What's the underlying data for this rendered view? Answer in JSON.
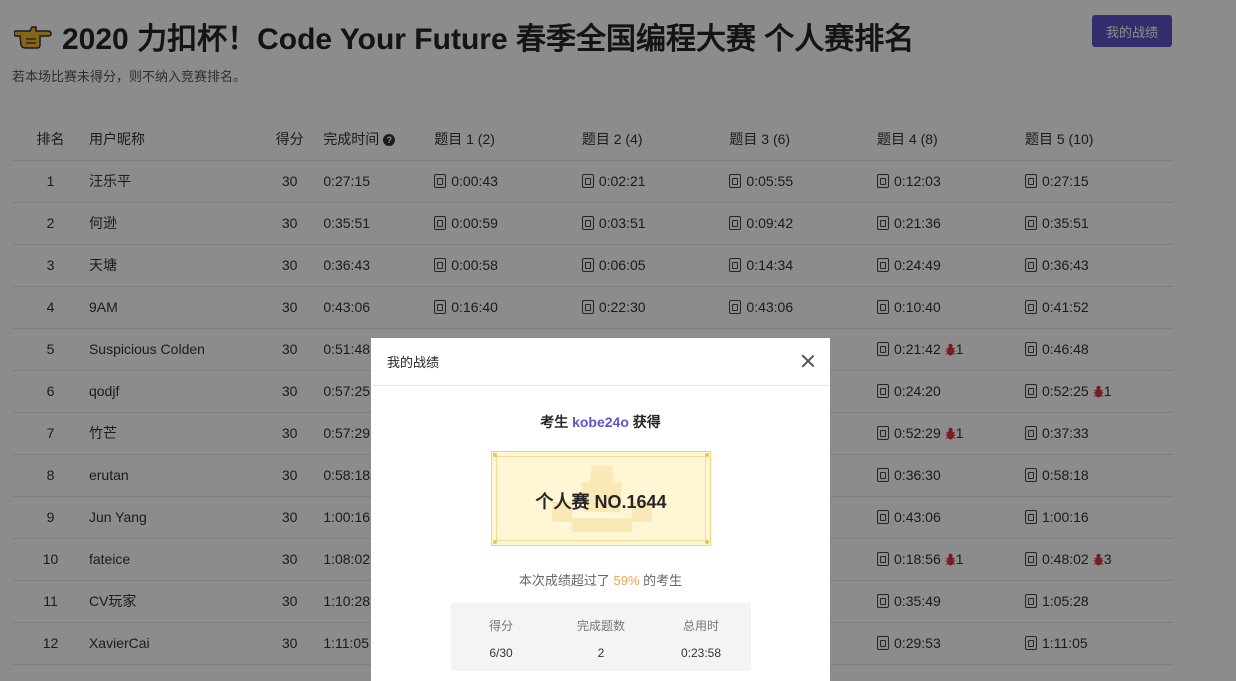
{
  "header": {
    "title": "2020 力扣杯！Code Your Future 春季全国编程大赛 个人赛排名",
    "my_results_button": "我的战绩",
    "subtitle": "若本场比赛未得分，则不纳入竞赛排名。"
  },
  "table": {
    "columns": [
      "排名",
      "用户昵称",
      "得分",
      "完成时间",
      "题目 1 (2)",
      "题目 2 (4)",
      "题目 3 (6)",
      "题目 4 (8)",
      "题目 5 (10)"
    ],
    "help_icon": "?",
    "rows": [
      {
        "rank": "1",
        "name": "汪乐平",
        "score": "30",
        "time": "0:27:15",
        "q1": "0:00:43",
        "q2": "0:02:21",
        "q3": "0:05:55",
        "q4": "0:12:03",
        "q5": "0:27:15"
      },
      {
        "rank": "2",
        "name": "何逊",
        "score": "30",
        "time": "0:35:51",
        "q1": "0:00:59",
        "q2": "0:03:51",
        "q3": "0:09:42",
        "q4": "0:21:36",
        "q5": "0:35:51"
      },
      {
        "rank": "3",
        "name": "天塘",
        "score": "30",
        "time": "0:36:43",
        "q1": "0:00:58",
        "q2": "0:06:05",
        "q3": "0:14:34",
        "q4": "0:24:49",
        "q5": "0:36:43"
      },
      {
        "rank": "4",
        "name": "9AM",
        "score": "30",
        "time": "0:43:06",
        "q1": "0:16:40",
        "q2": "0:22:30",
        "q3": "0:43:06",
        "q4": "0:10:40",
        "q5": "0:41:52"
      },
      {
        "rank": "5",
        "name": "Suspicious Colden",
        "score": "30",
        "time": "0:51:48",
        "q4": "0:21:42",
        "q4_bugs": "1",
        "q5": "0:46:48"
      },
      {
        "rank": "6",
        "name": "qodjf",
        "score": "30",
        "time": "0:57:25",
        "q4": "0:24:20",
        "q5": "0:52:25",
        "q5_bugs": "1"
      },
      {
        "rank": "7",
        "name": "竹芒",
        "score": "30",
        "time": "0:57:29",
        "q4": "0:52:29",
        "q4_bugs": "1",
        "q5": "0:37:33"
      },
      {
        "rank": "8",
        "name": "erutan",
        "score": "30",
        "time": "0:58:18",
        "q4": "0:36:30",
        "q5": "0:58:18"
      },
      {
        "rank": "9",
        "name": "Jun Yang",
        "score": "30",
        "time": "1:00:16",
        "q4": "0:43:06",
        "q5": "1:00:16"
      },
      {
        "rank": "10",
        "name": "fateice",
        "score": "30",
        "time": "1:08:02",
        "q4": "0:18:56",
        "q4_bugs": "1",
        "q5": "0:48:02",
        "q5_bugs": "3"
      },
      {
        "rank": "11",
        "name": "CV玩家",
        "score": "30",
        "time": "1:10:28",
        "q4": "0:35:49",
        "q5": "1:05:28"
      },
      {
        "rank": "12",
        "name": "XavierCai",
        "score": "30",
        "time": "1:11:05",
        "q4": "0:29:53",
        "q5": "1:11:05"
      }
    ]
  },
  "modal": {
    "title": "我的战绩",
    "line_prefix": "考生 ",
    "username": "kobe24o",
    "line_suffix": " 获得",
    "certificate": "个人赛 NO.1644",
    "beat_prefix": "本次成绩超过了 ",
    "beat_percent": "59%",
    "beat_suffix": " 的考生",
    "stats": [
      {
        "label": "得分",
        "value": "6/30"
      },
      {
        "label": "完成题数",
        "value": "2"
      },
      {
        "label": "总用时",
        "value": "0:23:58"
      }
    ]
  },
  "colors": {
    "accent": "#5d55c9",
    "percent": "#f0a54a",
    "bug": "#d9363e",
    "certificate_bg": "#fff6d6"
  }
}
